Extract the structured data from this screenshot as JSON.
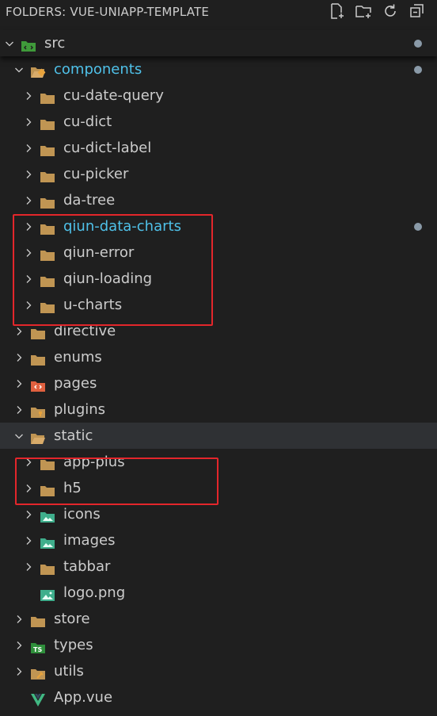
{
  "header": {
    "title": "FOLDERS: VUE-UNIAPP-TEMPLATE"
  },
  "header_icons": [
    "new-file-icon",
    "new-folder-icon",
    "refresh-icon",
    "collapse-all-icon"
  ],
  "tree": [
    {
      "label": "src",
      "level": 0,
      "expanded": true,
      "icon": "src-folder-icon",
      "modified": true
    },
    {
      "label": "components",
      "level": 1,
      "expanded": true,
      "icon": "components-folder-icon",
      "modified": true,
      "highlight": true
    },
    {
      "label": "cu-date-query",
      "level": 2,
      "expanded": false,
      "icon": "folder-icon"
    },
    {
      "label": "cu-dict",
      "level": 2,
      "expanded": false,
      "icon": "folder-icon"
    },
    {
      "label": "cu-dict-label",
      "level": 2,
      "expanded": false,
      "icon": "folder-icon"
    },
    {
      "label": "cu-picker",
      "level": 2,
      "expanded": false,
      "icon": "folder-icon"
    },
    {
      "label": "da-tree",
      "level": 2,
      "expanded": false,
      "icon": "folder-icon"
    },
    {
      "label": "qiun-data-charts",
      "level": 2,
      "expanded": false,
      "icon": "folder-icon",
      "modified": true,
      "highlight": true
    },
    {
      "label": "qiun-error",
      "level": 2,
      "expanded": false,
      "icon": "folder-icon"
    },
    {
      "label": "qiun-loading",
      "level": 2,
      "expanded": false,
      "icon": "folder-icon"
    },
    {
      "label": "u-charts",
      "level": 2,
      "expanded": false,
      "icon": "folder-icon"
    },
    {
      "label": "directive",
      "level": 1,
      "expanded": false,
      "icon": "folder-icon"
    },
    {
      "label": "enums",
      "level": 1,
      "expanded": false,
      "icon": "folder-icon"
    },
    {
      "label": "pages",
      "level": 1,
      "expanded": false,
      "icon": "pages-folder-icon"
    },
    {
      "label": "plugins",
      "level": 1,
      "expanded": false,
      "icon": "plugins-folder-icon"
    },
    {
      "label": "static",
      "level": 1,
      "expanded": true,
      "icon": "folder-open-icon",
      "selected": true
    },
    {
      "label": "app-plus",
      "level": 2,
      "expanded": false,
      "icon": "folder-icon"
    },
    {
      "label": "h5",
      "level": 2,
      "expanded": false,
      "icon": "folder-icon"
    },
    {
      "label": "icons",
      "level": 2,
      "expanded": false,
      "icon": "images-folder-icon"
    },
    {
      "label": "images",
      "level": 2,
      "expanded": false,
      "icon": "images-folder-icon"
    },
    {
      "label": "tabbar",
      "level": 2,
      "expanded": false,
      "icon": "folder-icon"
    },
    {
      "label": "logo.png",
      "level": 2,
      "file": true,
      "icon": "image-file-icon"
    },
    {
      "label": "store",
      "level": 1,
      "expanded": false,
      "icon": "folder-icon"
    },
    {
      "label": "types",
      "level": 1,
      "expanded": false,
      "icon": "ts-folder-icon"
    },
    {
      "label": "utils",
      "level": 1,
      "expanded": false,
      "icon": "utils-folder-icon"
    },
    {
      "label": "App.vue",
      "level": 1,
      "file": true,
      "icon": "vue-file-icon"
    }
  ],
  "colors": {
    "background": "#1f1f1f",
    "text": "#cccccc",
    "highlight_text": "#4fc1e9",
    "selection": "#2f3134",
    "annotation_box": "#e3262b",
    "folder": "#c09553"
  }
}
